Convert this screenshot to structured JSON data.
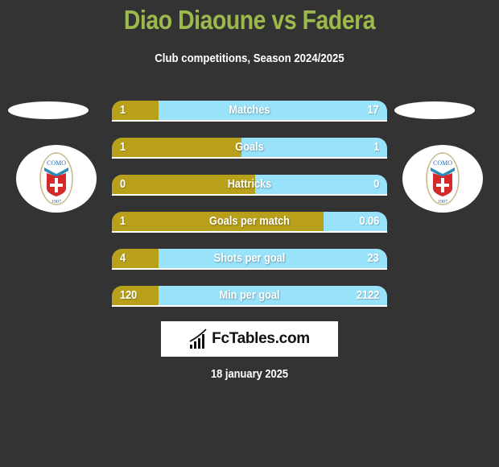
{
  "header": {
    "title": "Diao Diaoune vs Fadera",
    "subtitle": "Club competitions, Season 2024/2025"
  },
  "teams": {
    "left": {
      "club_name": "COMO",
      "founded": "1907",
      "icon": "como-crest-icon"
    },
    "right": {
      "club_name": "COMO",
      "founded": "1907",
      "icon": "como-crest-icon"
    }
  },
  "colors": {
    "background": "#333333",
    "title": "#9cba4b",
    "left_bar": "#b8a01a",
    "right_bar": "#99e3fa",
    "text": "#ffffff"
  },
  "stats": [
    {
      "label": "Matches",
      "left": "1",
      "right": "17",
      "left_share": 0.17
    },
    {
      "label": "Goals",
      "left": "1",
      "right": "1",
      "left_share": 0.47
    },
    {
      "label": "Hattricks",
      "left": "0",
      "right": "0",
      "left_share": 0.52
    },
    {
      "label": "Goals per match",
      "left": "1",
      "right": "0.06",
      "left_share": 0.77
    },
    {
      "label": "Shots per goal",
      "left": "4",
      "right": "23",
      "left_share": 0.17
    },
    {
      "label": "Min per goal",
      "left": "120",
      "right": "2122",
      "left_share": 0.17
    }
  ],
  "branding": {
    "logo_text": "FcTables.com",
    "logo_icon": "bar-chart-icon"
  },
  "footer": {
    "date": "18 january 2025"
  }
}
